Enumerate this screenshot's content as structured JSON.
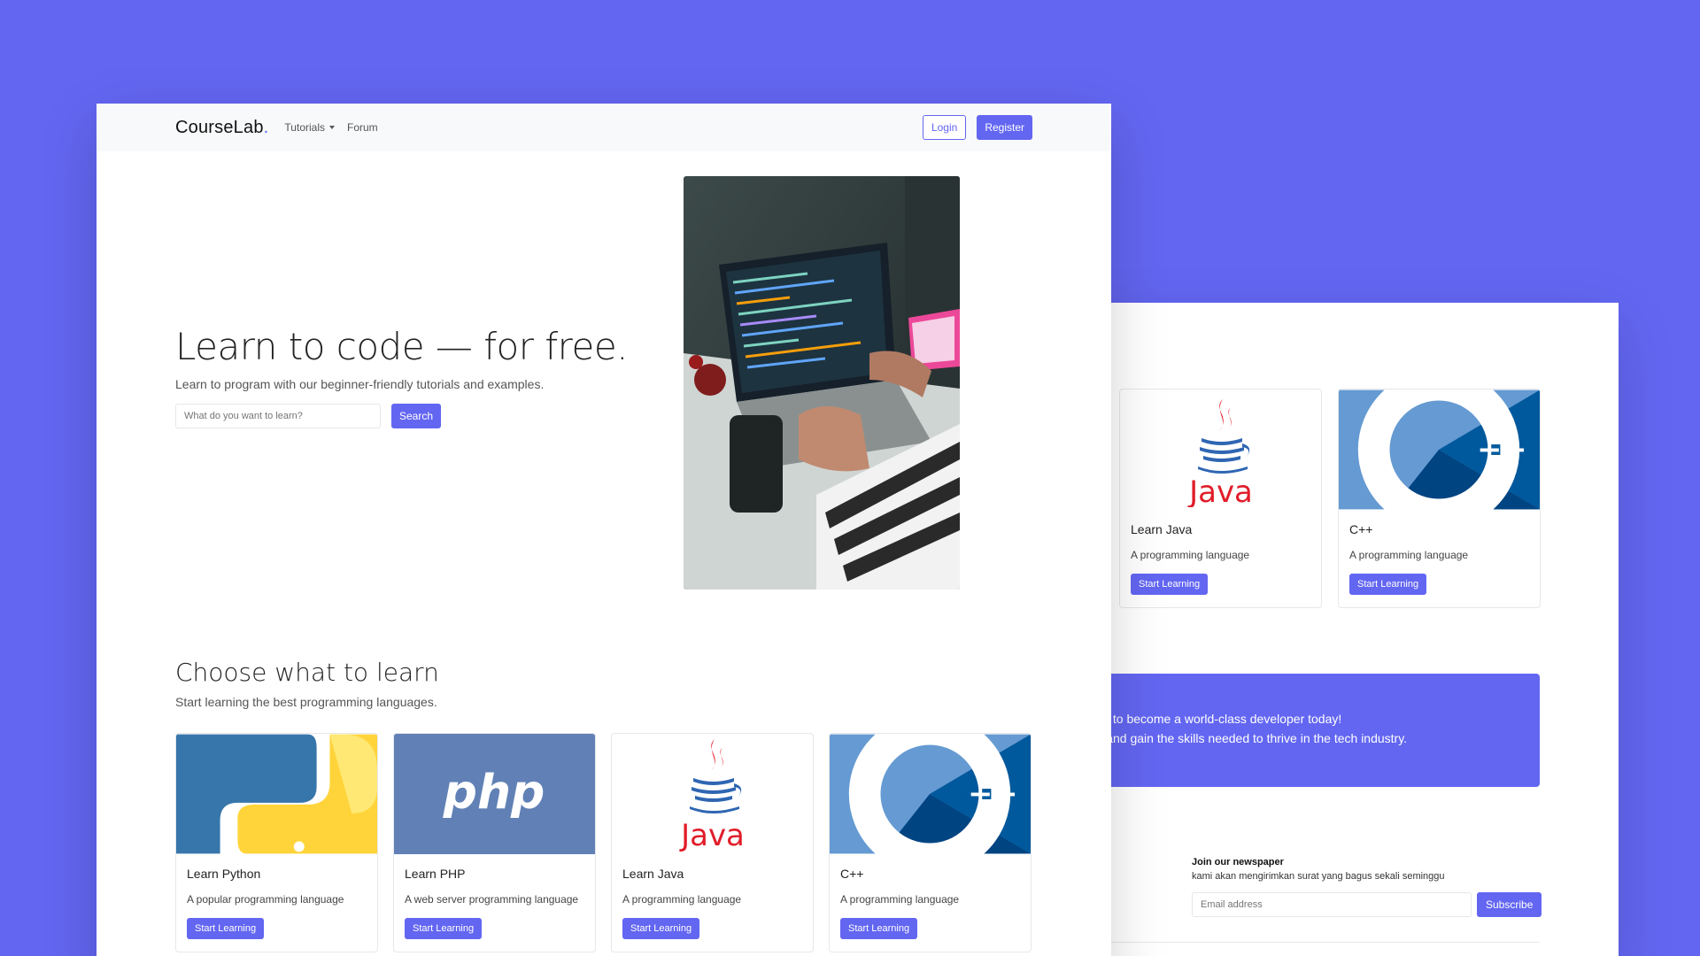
{
  "colors": {
    "brand": "#6366f1",
    "navbar_bg": "#f8f9fa"
  },
  "navbar": {
    "brand": "CourseLab",
    "brand_dot": ".",
    "tutorials": "Tutorials",
    "forum": "Forum",
    "login": "Login",
    "register": "Register"
  },
  "hero": {
    "title": "Learn to code — for free.",
    "subtitle": "Learn to program with our beginner-friendly tutorials and examples.",
    "search_placeholder": "What do you want to learn?",
    "search_button": "Search"
  },
  "courses": {
    "title": "Choose what to learn",
    "subtitle": "Start learning the best programming languages.",
    "items": [
      {
        "title": "Learn Python",
        "desc": "A popular programming language",
        "button": "Start Learning",
        "icon": "python-logo"
      },
      {
        "title": "Learn PHP",
        "desc": "A web server programming language",
        "button": "Start Learning",
        "icon": "php-logo",
        "logo_text": "php"
      },
      {
        "title": "Learn Java",
        "desc": "A programming language",
        "button": "Start Learning",
        "icon": "java-logo",
        "logo_text": "Java"
      },
      {
        "title": "C++",
        "desc": "A programming language",
        "button": "Start Learning",
        "icon": "cpp-logo"
      }
    ]
  },
  "back_page": {
    "cards": [
      {
        "title": "Learn Java",
        "desc": "A programming language",
        "button": "Start Learning",
        "logo_text": "Java"
      },
      {
        "title": "C++",
        "desc": "A programming language",
        "button": "Start Learning"
      }
    ],
    "banner": {
      "line1": "urney to become a world-class developer today!",
      "line2": "ers, and gain the skills needed to thrive in the tech industry."
    },
    "newsletter": {
      "title": "Join our newspaper",
      "subtitle": "kami akan mengirimkan surat yang bagus sekali seminggu",
      "placeholder": "Email address",
      "button": "Subscribe"
    }
  }
}
